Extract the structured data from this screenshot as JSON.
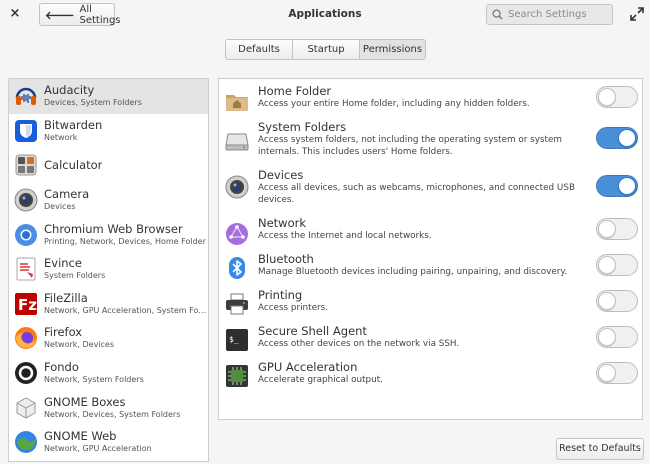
{
  "header": {
    "close_label": "×",
    "back_label": "All Settings",
    "title": "Applications",
    "search_placeholder": "Search Settings"
  },
  "tabs": [
    {
      "label": "Defaults",
      "selected": false
    },
    {
      "label": "Startup",
      "selected": false
    },
    {
      "label": "Permissions",
      "selected": true
    }
  ],
  "apps": [
    {
      "name": "Audacity",
      "desc": "Devices, System Folders",
      "icon": "audacity-icon",
      "selected": true
    },
    {
      "name": "Bitwarden",
      "desc": "Network",
      "icon": "bitwarden-icon"
    },
    {
      "name": "Calculator",
      "desc": "",
      "icon": "calculator-icon"
    },
    {
      "name": "Camera",
      "desc": "Devices",
      "icon": "camera-icon"
    },
    {
      "name": "Chromium Web Browser",
      "desc": "Printing, Network, Devices, Home Folder",
      "icon": "chromium-icon"
    },
    {
      "name": "Evince",
      "desc": "System Folders",
      "icon": "evince-icon"
    },
    {
      "name": "FileZilla",
      "desc": "Network, GPU Acceleration, System Fo…",
      "icon": "filezilla-icon"
    },
    {
      "name": "Firefox",
      "desc": "Network, Devices",
      "icon": "firefox-icon"
    },
    {
      "name": "Fondo",
      "desc": "Network, System Folders",
      "icon": "fondo-icon"
    },
    {
      "name": "GNOME Boxes",
      "desc": "Network, Devices, System Folders",
      "icon": "gnome-boxes-icon"
    },
    {
      "name": "GNOME Web",
      "desc": "Network, GPU Acceleration",
      "icon": "gnome-web-icon"
    }
  ],
  "permissions": [
    {
      "title": "Home Folder",
      "desc": "Access your entire Home folder, including any hidden folders.",
      "icon": "home-folder-icon",
      "enabled": false
    },
    {
      "title": "System Folders",
      "desc": "Access system folders, not including the operating system or system internals. This includes users' Home folders.",
      "icon": "hard-drive-icon",
      "enabled": true
    },
    {
      "title": "Devices",
      "desc": "Access all devices, such as webcams, microphones, and connected USB devices.",
      "icon": "webcam-icon",
      "enabled": true
    },
    {
      "title": "Network",
      "desc": "Access the Internet and local networks.",
      "icon": "network-icon",
      "enabled": false
    },
    {
      "title": "Bluetooth",
      "desc": "Manage Bluetooth devices including pairing, unpairing, and discovery.",
      "icon": "bluetooth-icon",
      "enabled": false
    },
    {
      "title": "Printing",
      "desc": "Access printers.",
      "icon": "printer-icon",
      "enabled": false
    },
    {
      "title": "Secure Shell Agent",
      "desc": "Access other devices on the network via SSH.",
      "icon": "terminal-icon",
      "enabled": false
    },
    {
      "title": "GPU Acceleration",
      "desc": "Accelerate graphical output.",
      "icon": "gpu-chip-icon",
      "enabled": false
    }
  ],
  "reset_label": "Reset to Defaults",
  "colors": {
    "accent": "#4a90d9",
    "selected_row": "#e4e4e4"
  }
}
